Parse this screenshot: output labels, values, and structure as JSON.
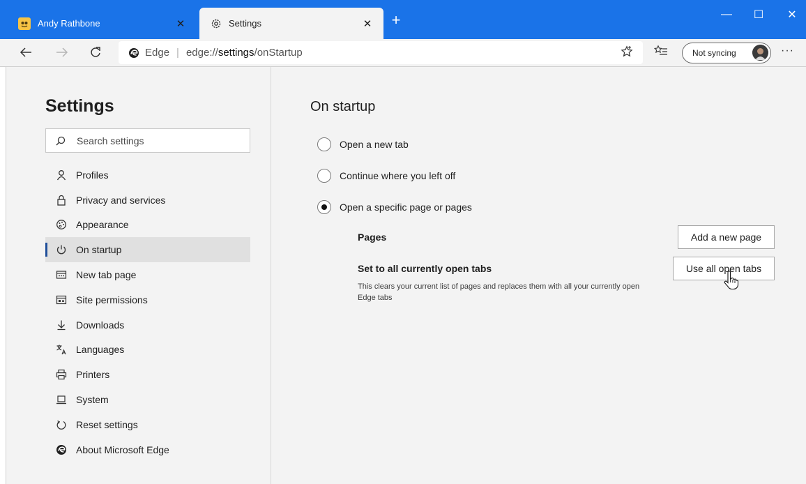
{
  "colors": {
    "titlebar": "#1a73e8",
    "accent": "#1f4e9a",
    "page_bg": "#f3f3f3"
  },
  "tabs": [
    {
      "title": "Andy Rathbone",
      "icon": "avatar-favicon-icon",
      "active": false
    },
    {
      "title": "Settings",
      "icon": "gear-icon",
      "active": true
    }
  ],
  "window": {
    "minimize_glyph": "—",
    "maximize_glyph": "☐",
    "close_glyph": "✕",
    "new_tab_glyph": "+",
    "tab_close_glyph": "✕"
  },
  "toolbar": {
    "address_host": "Edge",
    "address_sep": "|",
    "url_prefix": "edge://",
    "url_strong": "settings",
    "url_suffix": "/onStartup",
    "sync_label": "Not syncing",
    "more_glyph": "···"
  },
  "sidebar": {
    "heading": "Settings",
    "search_placeholder": "Search settings",
    "items": [
      {
        "label": "Profiles",
        "icon": "person-icon",
        "active": false
      },
      {
        "label": "Privacy and services",
        "icon": "lock-icon",
        "active": false
      },
      {
        "label": "Appearance",
        "icon": "palette-icon",
        "active": false
      },
      {
        "label": "On startup",
        "icon": "power-icon",
        "active": true
      },
      {
        "label": "New tab page",
        "icon": "new-tab-page-icon",
        "active": false
      },
      {
        "label": "Site permissions",
        "icon": "site-permissions-icon",
        "active": false
      },
      {
        "label": "Downloads",
        "icon": "download-icon",
        "active": false
      },
      {
        "label": "Languages",
        "icon": "languages-icon",
        "active": false
      },
      {
        "label": "Printers",
        "icon": "printer-icon",
        "active": false
      },
      {
        "label": "System",
        "icon": "laptop-icon",
        "active": false
      },
      {
        "label": "Reset settings",
        "icon": "reset-icon",
        "active": false
      },
      {
        "label": "About Microsoft Edge",
        "icon": "edge-logo-icon",
        "active": false
      }
    ]
  },
  "main": {
    "title": "On startup",
    "options": [
      {
        "label": "Open a new tab",
        "selected": false
      },
      {
        "label": "Continue where you left off",
        "selected": false
      },
      {
        "label": "Open a specific page or pages",
        "selected": true
      }
    ],
    "pages_label": "Pages",
    "add_page_button": "Add a new page",
    "set_all_label": "Set to all currently open tabs",
    "set_all_desc": "This clears your current list of pages and replaces them with all your currently open Edge tabs",
    "use_all_button": "Use all open tabs"
  }
}
